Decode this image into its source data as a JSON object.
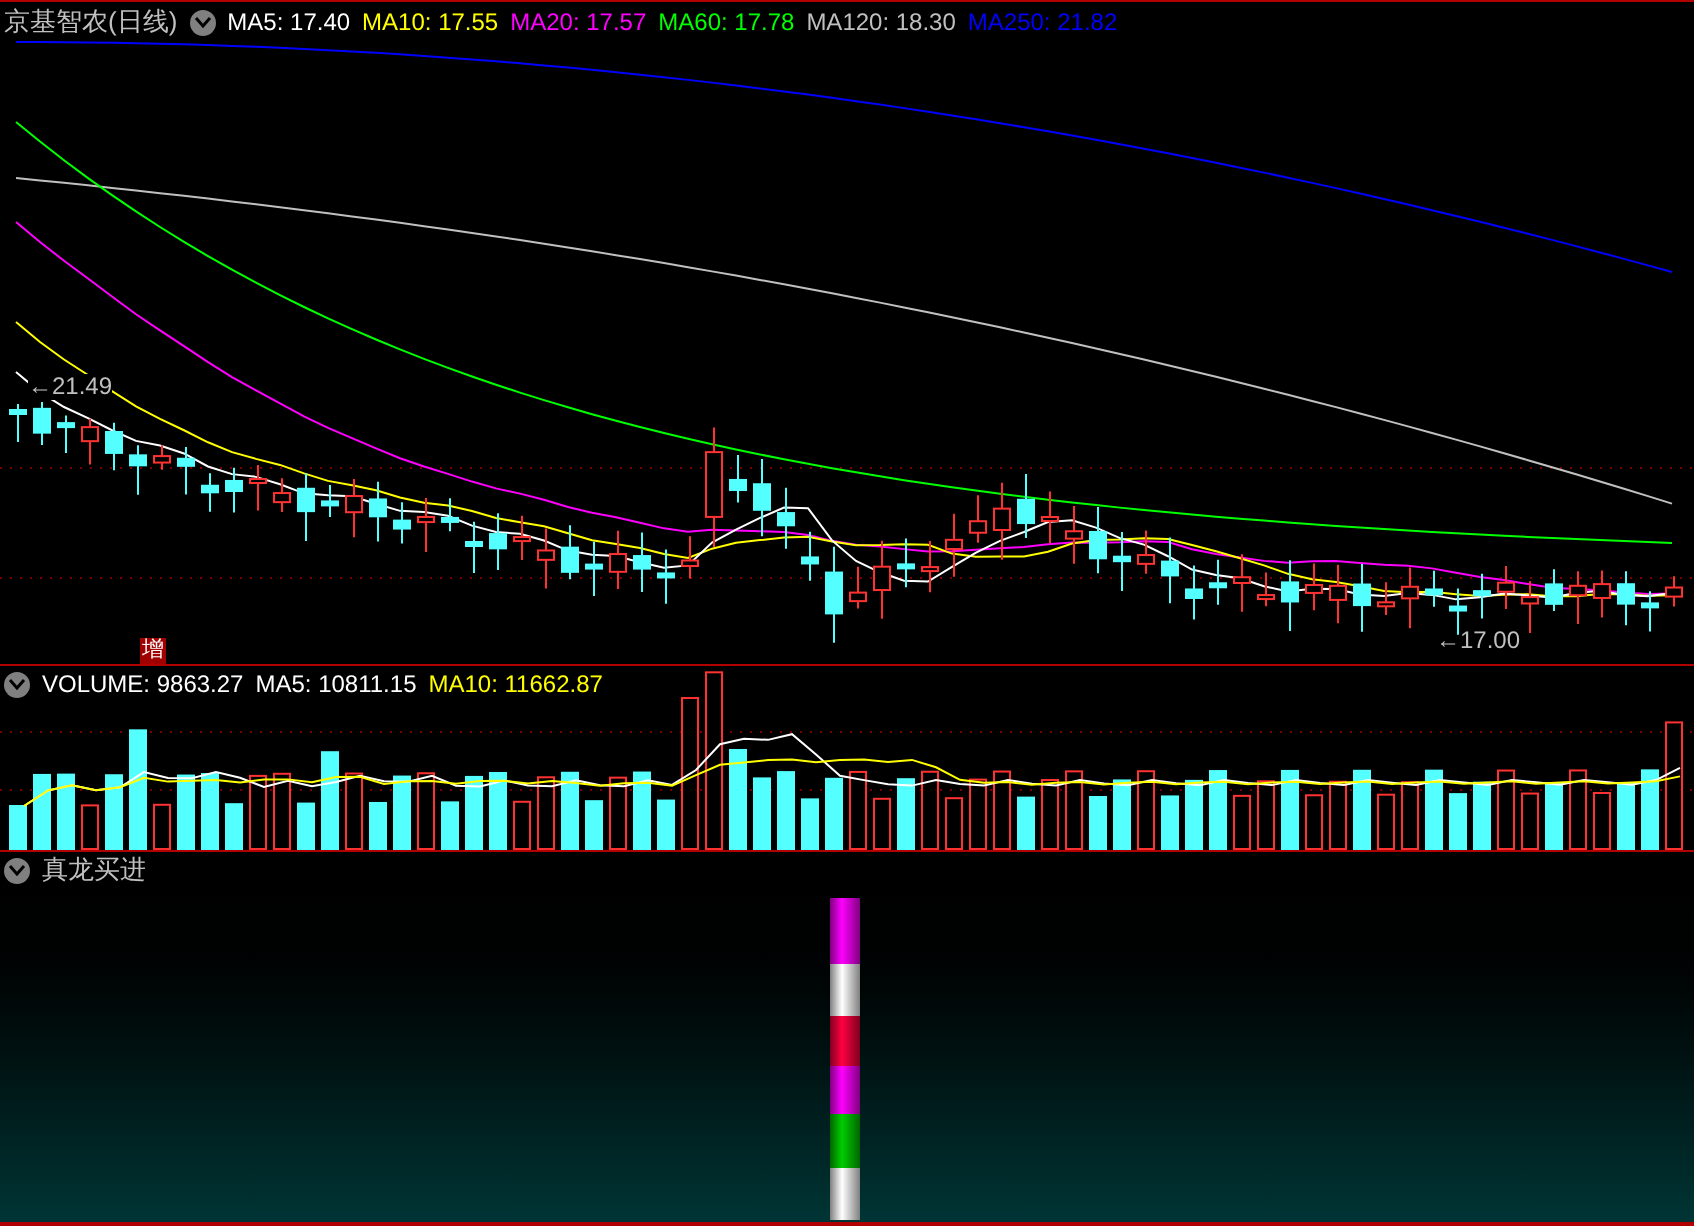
{
  "price_panel": {
    "title": "京基智农(日线)",
    "indicators": [
      {
        "label": "MA5: 17.40",
        "color": "#ffffff"
      },
      {
        "label": "MA10: 17.55",
        "color": "#ffff00"
      },
      {
        "label": "MA20: 17.57",
        "color": "#ff00ff"
      },
      {
        "label": "MA60: 17.78",
        "color": "#00ff00"
      },
      {
        "label": "MA120: 18.30",
        "color": "#c0c0c0"
      },
      {
        "label": "MA250: 21.82",
        "color": "#0000ff"
      }
    ],
    "high_label": "←21.49",
    "low_label": "←17.00",
    "badge": "增"
  },
  "volume_panel": {
    "indicators": [
      {
        "label": "VOLUME: 9863.27",
        "color": "#ffffff"
      },
      {
        "label": "MA5: 10811.15",
        "color": "#ffffff"
      },
      {
        "label": "MA10: 11662.87",
        "color": "#ffff00"
      }
    ]
  },
  "signal_panel": {
    "title": "真龙买进"
  }
}
